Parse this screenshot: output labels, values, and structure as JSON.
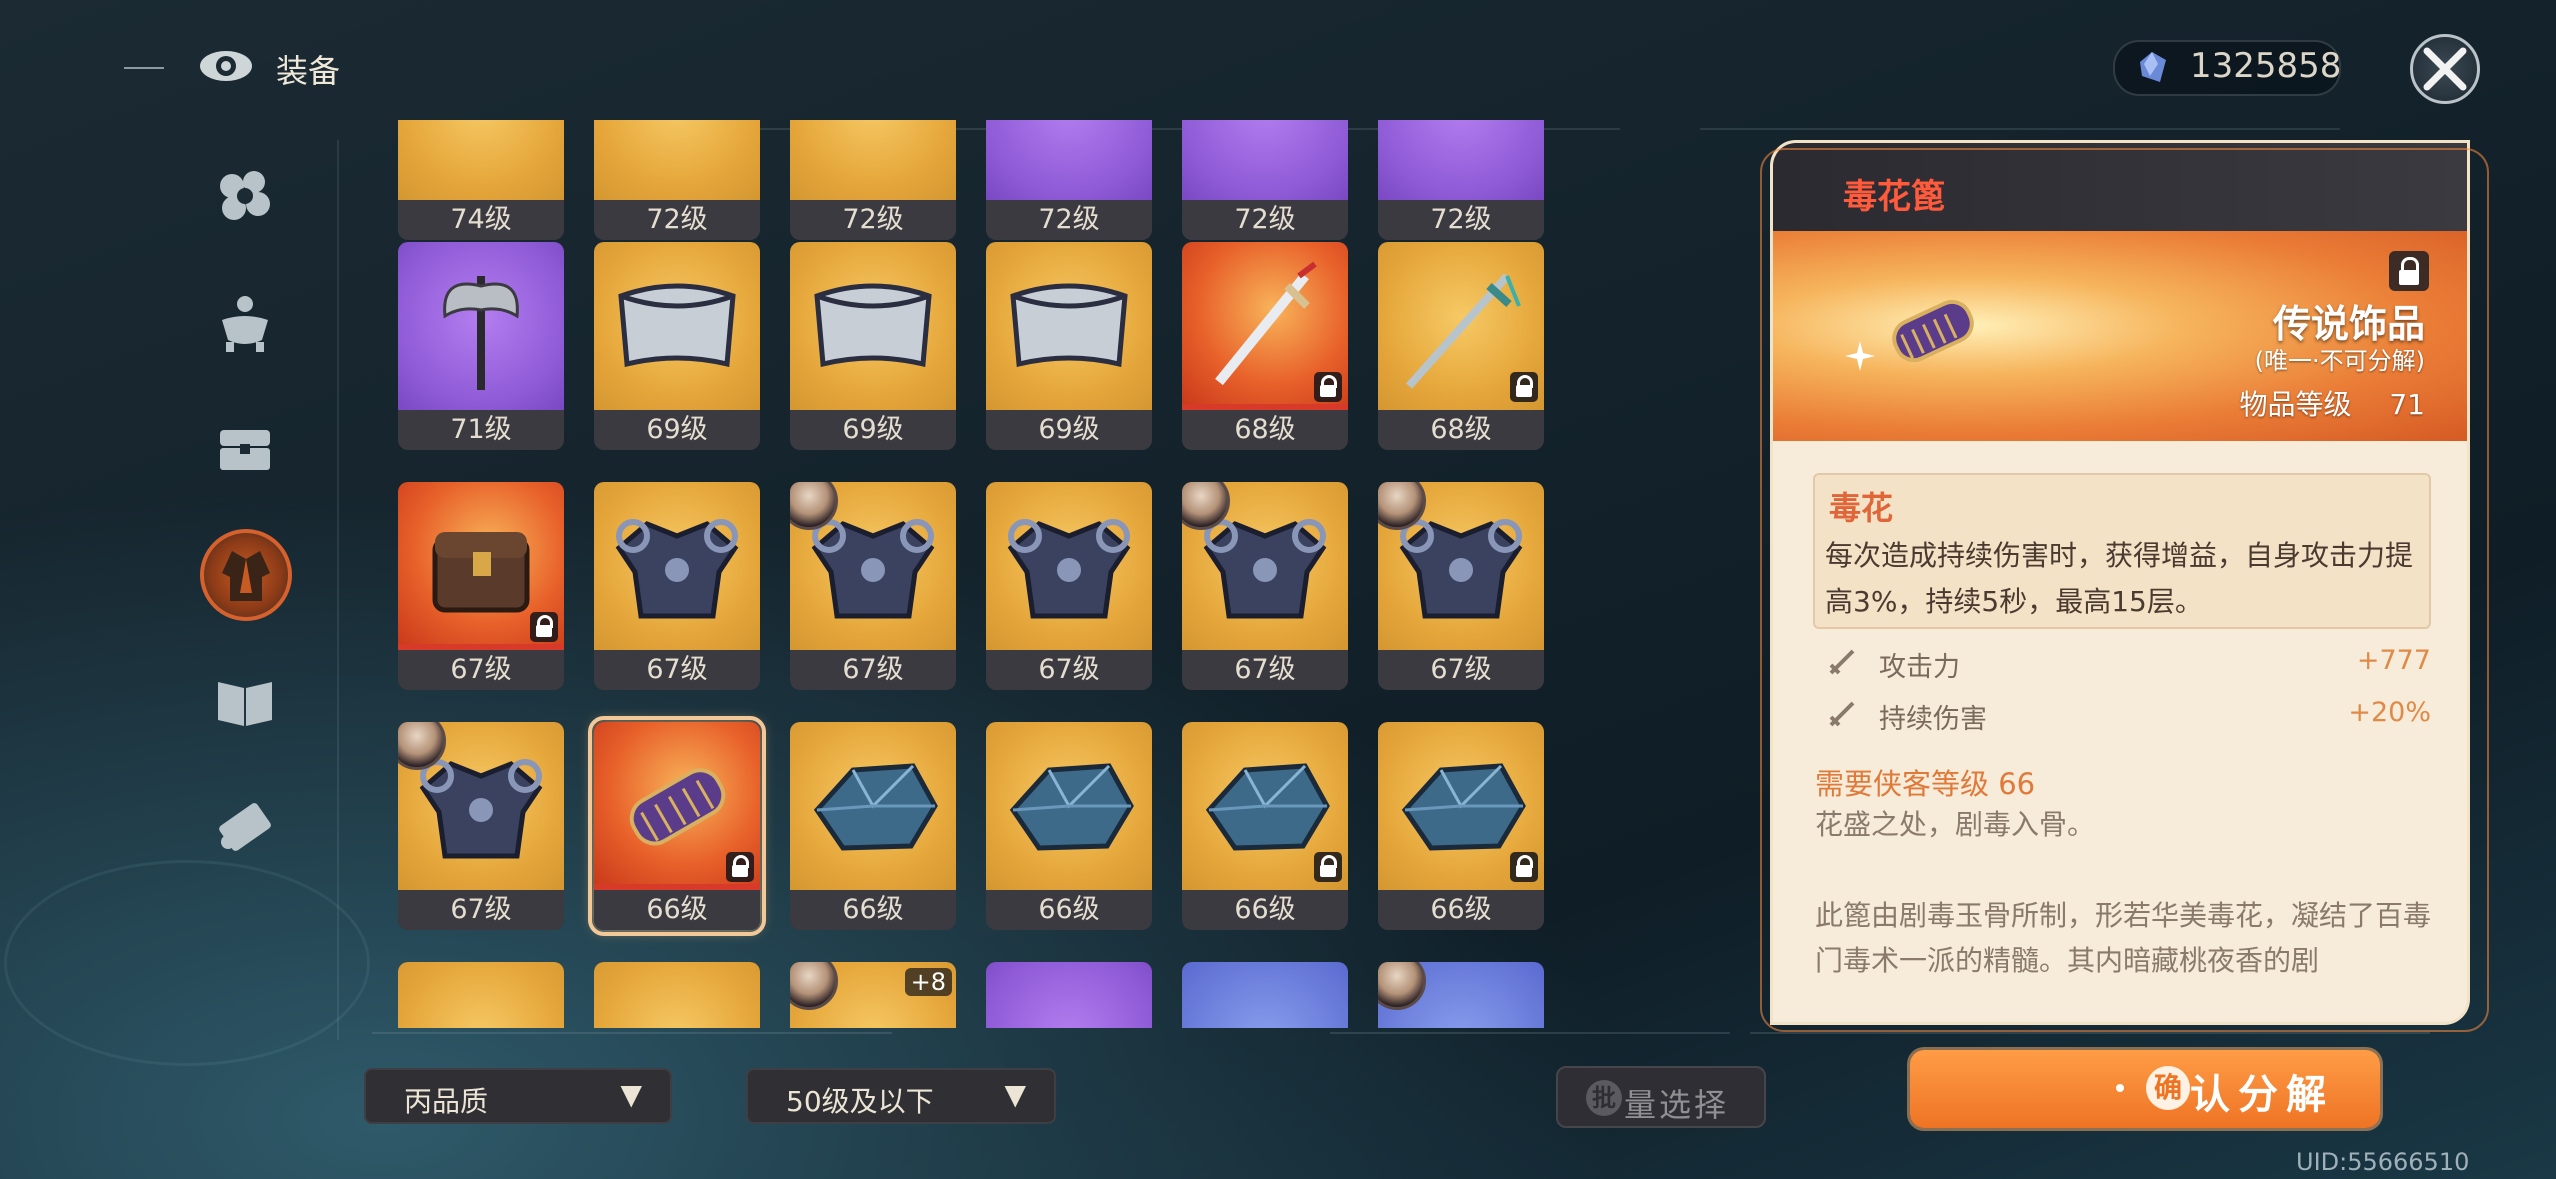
{
  "header": {
    "title": "装备",
    "currency_value": "1325858",
    "close_icon": "close-icon"
  },
  "sidebar": {
    "items": [
      {
        "icon": "flower-icon",
        "active": false
      },
      {
        "icon": "incense-burner-icon",
        "active": false
      },
      {
        "icon": "chest-icon",
        "active": false
      },
      {
        "icon": "robe-icon",
        "active": true
      },
      {
        "icon": "book-icon",
        "active": false
      },
      {
        "icon": "scroll-icon",
        "active": false
      }
    ]
  },
  "grid": {
    "rows": [
      [
        {
          "level": "74级",
          "rarity": "gold"
        },
        {
          "level": "72级",
          "rarity": "gold"
        },
        {
          "level": "72级",
          "rarity": "gold"
        },
        {
          "level": "72级",
          "rarity": "purple"
        },
        {
          "level": "72级",
          "rarity": "purple"
        },
        {
          "level": "72级",
          "rarity": "purple"
        }
      ],
      [
        {
          "level": "71级",
          "rarity": "purple",
          "item": "axe"
        },
        {
          "level": "69级",
          "rarity": "gold",
          "item": "belt"
        },
        {
          "level": "69级",
          "rarity": "gold",
          "item": "belt"
        },
        {
          "level": "69级",
          "rarity": "gold",
          "item": "belt"
        },
        {
          "level": "68级",
          "rarity": "red",
          "item": "sword",
          "locked": true
        },
        {
          "level": "68级",
          "rarity": "gold",
          "item": "sword2",
          "locked": true
        }
      ],
      [
        {
          "level": "67级",
          "rarity": "red",
          "item": "chest",
          "locked": true
        },
        {
          "level": "67级",
          "rarity": "gold",
          "item": "armor"
        },
        {
          "level": "67级",
          "rarity": "gold",
          "item": "armor",
          "avatar": true
        },
        {
          "level": "67级",
          "rarity": "gold",
          "item": "armor"
        },
        {
          "level": "67级",
          "rarity": "gold",
          "item": "armor",
          "avatar": true
        },
        {
          "level": "67级",
          "rarity": "gold",
          "item": "armor",
          "avatar": true
        }
      ],
      [
        {
          "level": "67级",
          "rarity": "gold",
          "item": "armor",
          "avatar": true
        },
        {
          "level": "66级",
          "rarity": "red",
          "item": "comb",
          "locked": true,
          "selected": true
        },
        {
          "level": "66级",
          "rarity": "gold",
          "item": "stone"
        },
        {
          "level": "66级",
          "rarity": "gold",
          "item": "stone"
        },
        {
          "level": "66级",
          "rarity": "gold",
          "item": "stone",
          "locked": true
        },
        {
          "level": "66级",
          "rarity": "gold",
          "item": "stone",
          "locked": true
        }
      ],
      [
        {
          "level": "",
          "rarity": "gold"
        },
        {
          "level": "",
          "rarity": "gold"
        },
        {
          "level": "",
          "rarity": "gold",
          "avatar": true,
          "plus": "+8"
        },
        {
          "level": "",
          "rarity": "purple"
        },
        {
          "level": "",
          "rarity": "blue"
        },
        {
          "level": "",
          "rarity": "blue",
          "avatar": true
        }
      ]
    ]
  },
  "detail": {
    "name": "毒花篦",
    "rarity": "传说饰品",
    "unique": "(唯一·不可分解)",
    "item_level_label": "物品等级",
    "item_level": "71",
    "skill_name": "毒花",
    "skill_desc": "每次造成持续伤害时，获得增益，自身攻击力提高3%，持续5秒，最高15层。",
    "stats": [
      {
        "name": "攻击力",
        "value": "+777"
      },
      {
        "name": "持续伤害",
        "value": "+20%"
      }
    ],
    "requirement": "需要侠客等级 66",
    "flavor": "花盛之处，剧毒入骨。",
    "lore": "此篦由剧毒玉骨所制，形若华美毒花，凝结了百毒门毒术一派的精髓。其内暗藏桃夜香的剧"
  },
  "bottom": {
    "quality_filter": "丙品质",
    "level_filter": "50级及以下",
    "batch_icon_text": "批",
    "batch_label": "量选择",
    "confirm_icon_text": "确",
    "confirm_label": "认分解",
    "uid": "UID:55666510"
  },
  "colors": {
    "accent": "#ee7424",
    "item_name": "#ff5a3c",
    "gold": "#e6a83c",
    "purple": "#8e5ad6",
    "red": "#e8612a"
  }
}
